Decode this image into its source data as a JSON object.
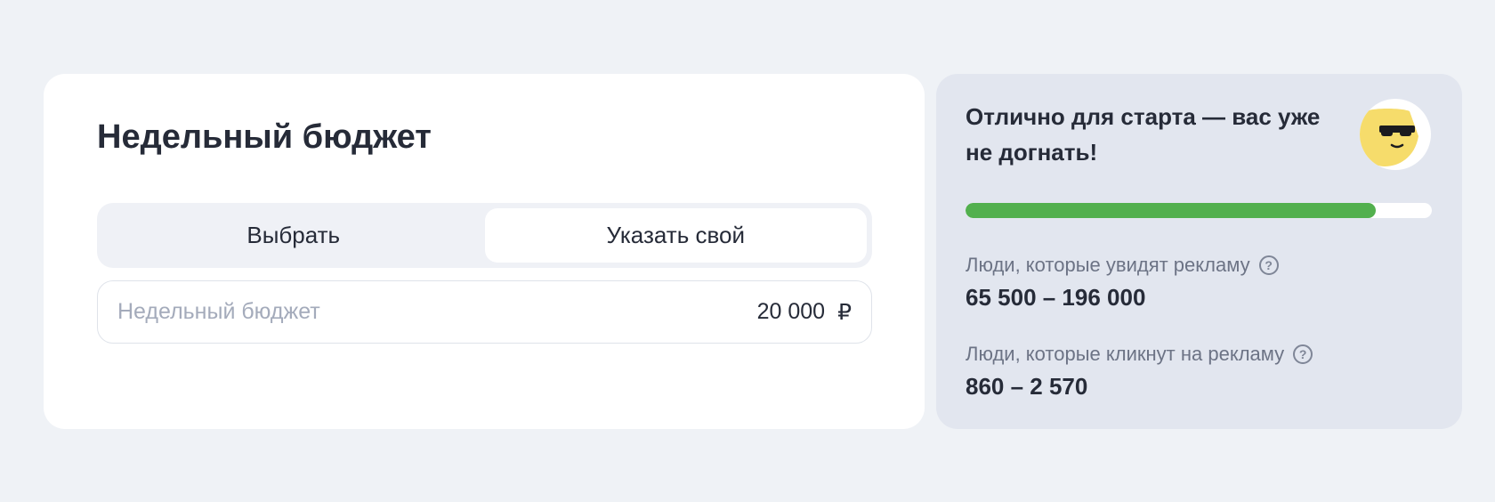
{
  "budget": {
    "title": "Недельный бюджет",
    "tabs": [
      {
        "label": "Выбрать",
        "active": false
      },
      {
        "label": "Указать свой",
        "active": true
      }
    ],
    "input": {
      "placeholder": "Недельный бюджет",
      "value": "20 000",
      "currency": "₽"
    }
  },
  "forecast": {
    "heading": "Отлично для старта — вас уже не догнать!",
    "mascot_icon": "sunglasses-face-icon",
    "progress_fraction": 0.88,
    "stats": [
      {
        "label": "Люди, которые увидят рекламу",
        "value": "65 500 – 196 000",
        "help_icon": "question-icon"
      },
      {
        "label": "Люди, которые кликнут на рекламу",
        "value": "860 – 2 570",
        "help_icon": "question-icon"
      }
    ]
  },
  "colors": {
    "background": "#eff2f6",
    "progress_fill": "#52b04e",
    "forecast_bg": "#e2e6ef",
    "mascot_yellow": "#f6dc6b"
  }
}
